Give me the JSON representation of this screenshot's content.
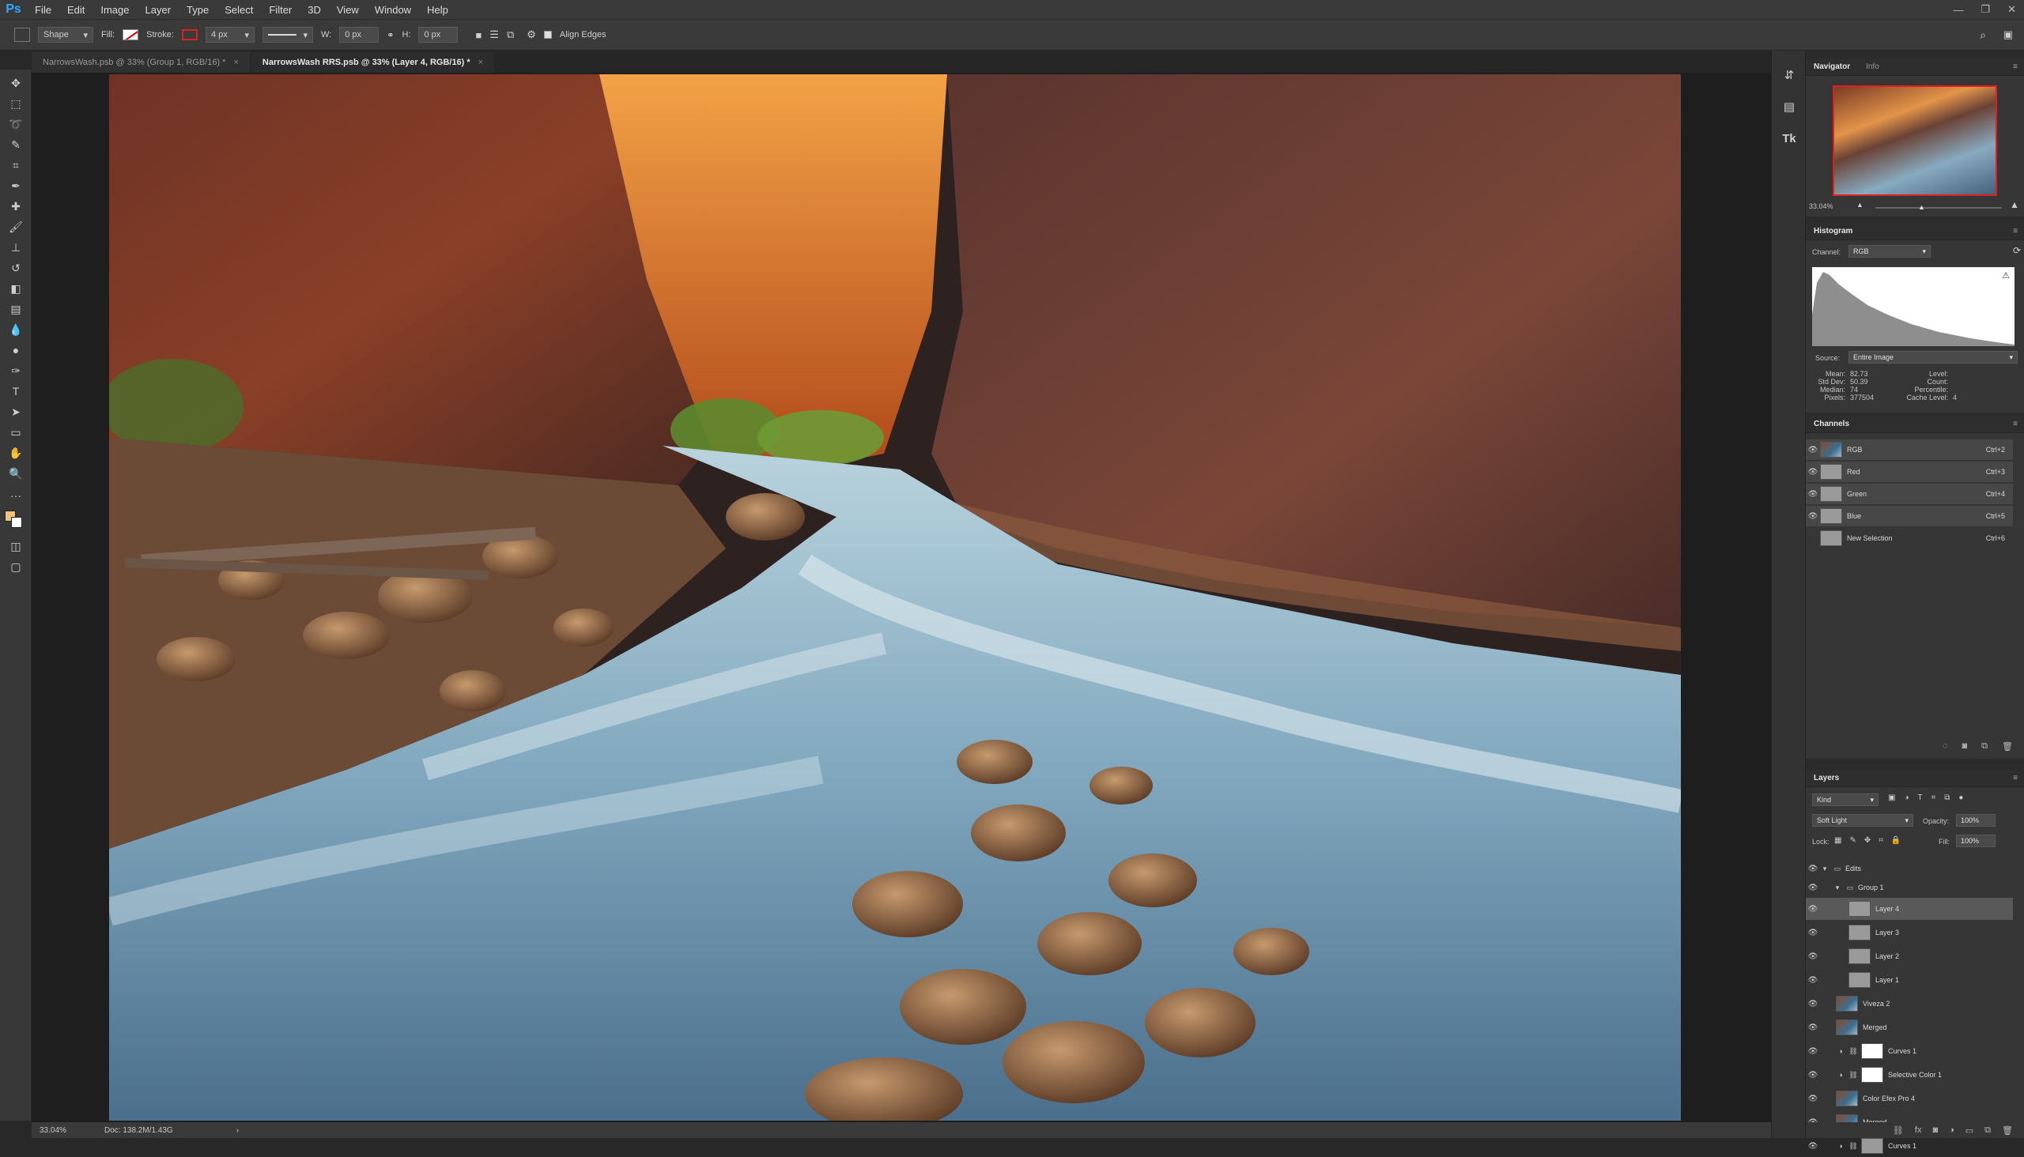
{
  "app": {
    "logo": "Ps"
  },
  "menu": [
    "File",
    "Edit",
    "Image",
    "Layer",
    "Type",
    "Select",
    "Filter",
    "3D",
    "View",
    "Window",
    "Help"
  ],
  "window_controls": [
    "—",
    "❐",
    "✕"
  ],
  "options_bar": {
    "tool_mode": "Shape",
    "fill_label": "Fill:",
    "stroke_label": "Stroke:",
    "stroke_width": "4 px",
    "w_label": "W:",
    "w_value": "0 px",
    "h_label": "H:",
    "h_value": "0 px",
    "align_edges": "Align Edges"
  },
  "tabs": [
    {
      "label": "NarrowsWash.psb @ 33% (Group 1, RGB/16) *",
      "close": "×"
    },
    {
      "label": "NarrowsWash RRS.psb @ 33% (Layer 4, RGB/16) *",
      "close": "×"
    }
  ],
  "status": {
    "zoom": "33.04%",
    "doc": "Doc: 138.2M/1.43G",
    "arrow": "›"
  },
  "navigator": {
    "tabs": [
      "Navigator",
      "Info"
    ],
    "zoom": "33.04%"
  },
  "histogram": {
    "title": "Histogram",
    "channel_label": "Channel:",
    "channel_value": "RGB",
    "source_label": "Source:",
    "source_value": "Entire Image",
    "stats_left": [
      {
        "label": "Mean:",
        "value": "82.73"
      },
      {
        "label": "Std Dev:",
        "value": "50.39"
      },
      {
        "label": "Median:",
        "value": "74"
      },
      {
        "label": "Pixels:",
        "value": "377504"
      }
    ],
    "stats_right": [
      {
        "label": "Level:",
        "value": ""
      },
      {
        "label": "Count:",
        "value": ""
      },
      {
        "label": "Percentile:",
        "value": ""
      },
      {
        "label": "Cache Level:",
        "value": "4"
      }
    ]
  },
  "channels": {
    "title": "Channels",
    "items": [
      {
        "name": "RGB",
        "shortcut": "Ctrl+2"
      },
      {
        "name": "Red",
        "shortcut": "Ctrl+3"
      },
      {
        "name": "Green",
        "shortcut": "Ctrl+4"
      },
      {
        "name": "Blue",
        "shortcut": "Ctrl+5"
      },
      {
        "name": "New Selection",
        "shortcut": "Ctrl+6"
      }
    ]
  },
  "layers": {
    "title": "Layers",
    "filter_kind": "Kind",
    "blend_mode": "Soft Light",
    "opacity_label": "Opacity:",
    "opacity_value": "100%",
    "lock_label": "Lock:",
    "fill_label": "Fill:",
    "fill_value": "100%",
    "items": [
      {
        "name": "Edits",
        "kind": "group"
      },
      {
        "name": "Group 1",
        "kind": "group"
      },
      {
        "name": "Layer 4",
        "kind": "layer"
      },
      {
        "name": "Layer 3",
        "kind": "layer"
      },
      {
        "name": "Layer 2",
        "kind": "layer"
      },
      {
        "name": "Layer 1",
        "kind": "layer"
      },
      {
        "name": "Viveza 2",
        "kind": "image"
      },
      {
        "name": "Merged",
        "kind": "image"
      },
      {
        "name": "Curves 1",
        "kind": "adjustment"
      },
      {
        "name": "Selective Color 1",
        "kind": "adjustment"
      },
      {
        "name": "Color Efex Pro 4",
        "kind": "image"
      },
      {
        "name": "Merged",
        "kind": "image"
      },
      {
        "name": "Curves 1",
        "kind": "adjustment"
      }
    ]
  },
  "colors": {
    "foreground": "#f2c27a",
    "background": "#ffffff",
    "accent": "#31a8ff",
    "stroke": "#dd2222"
  }
}
